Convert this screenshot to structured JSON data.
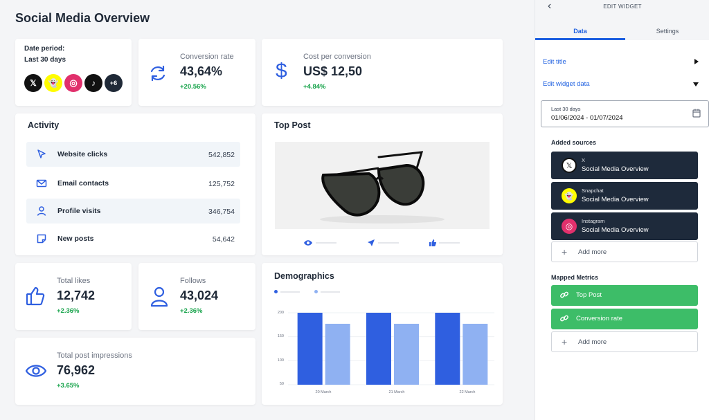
{
  "page": {
    "title": "Social Media Overview"
  },
  "date_card": {
    "label": "Date period:",
    "value": "Last 30 days",
    "networks": [
      {
        "name": "X",
        "glyph": "𝕏",
        "icon": "x-logo-icon"
      },
      {
        "name": "Snapchat",
        "glyph": "👻",
        "icon": "snapchat-logo-icon"
      },
      {
        "name": "Instagram",
        "glyph": "◎",
        "icon": "instagram-logo-icon"
      },
      {
        "name": "TikTok",
        "glyph": "♪",
        "icon": "tiktok-logo-icon"
      }
    ],
    "more_count": "+6"
  },
  "conversion": {
    "label": "Conversion rate",
    "value": "43,64%",
    "change": "+20.56%",
    "icon": "refresh-icon"
  },
  "cost": {
    "label": "Cost per conversion",
    "value": "US$ 12,50",
    "change": "+4.84%",
    "icon": "dollar-icon"
  },
  "activity": {
    "title": "Activity",
    "rows": [
      {
        "label": "Website clicks",
        "value": "542,852",
        "icon": "cursor-icon"
      },
      {
        "label": "Email contacts",
        "value": "125,752",
        "icon": "mail-icon"
      },
      {
        "label": "Profile visits",
        "value": "346,754",
        "icon": "user-icon"
      },
      {
        "label": "New posts",
        "value": "54,642",
        "icon": "note-icon"
      }
    ]
  },
  "top_post": {
    "title": "Top Post",
    "image": "sunglasses-image",
    "stats_icons": [
      "eye-icon",
      "share-icon",
      "thumbs-up-icon"
    ]
  },
  "likes": {
    "label": "Total likes",
    "value": "12,742",
    "change": "+2.36%",
    "icon": "thumbs-up-icon"
  },
  "follows": {
    "label": "Follows",
    "value": "43,024",
    "change": "+2.36%",
    "icon": "user-icon"
  },
  "impressions": {
    "label": "Total post impressions",
    "value": "76,962",
    "change": "+3.65%",
    "icon": "eye-icon"
  },
  "demographics": {
    "title": "Demographics",
    "colors": {
      "series1": "#2f5fe0",
      "series2": "#8fb1f2"
    },
    "chart_data": {
      "type": "bar",
      "categories": [
        "20 March",
        "21 March",
        "22 March"
      ],
      "series": [
        {
          "values": [
            200,
            200,
            200
          ]
        },
        {
          "values": [
            177,
            177,
            177
          ]
        }
      ],
      "yticks": [
        "200",
        "150",
        "100",
        "50"
      ],
      "ylim": [
        50,
        200
      ],
      "grid": true,
      "legend": "top-left"
    }
  },
  "panel": {
    "header": "EDIT WIDGET",
    "back_glyph": "‹",
    "tabs": [
      {
        "label": "Data",
        "active": true
      },
      {
        "label": "Settings",
        "active": false
      }
    ],
    "edit_title": "Edit title",
    "edit_data": "Edit widget data",
    "date_small": "Last 30 days",
    "date_range": "01/06/2024 - 01/07/2024",
    "added_sources_label": "Added sources",
    "sources": [
      {
        "network": "X",
        "name": "Social Media Overview",
        "glyph": "𝕏",
        "icon": "x-logo-icon"
      },
      {
        "network": "Snapchat",
        "name": "Social Media Overview",
        "glyph": "👻",
        "icon": "snapchat-logo-icon"
      },
      {
        "network": "Instagram",
        "name": "Social Media Overview",
        "glyph": "◎",
        "icon": "instagram-logo-icon"
      }
    ],
    "add_more": "Add more",
    "mapped_metrics_label": "Mapped Metrics",
    "metrics": [
      {
        "label": "Top Post"
      },
      {
        "label": "Conversion rate"
      }
    ],
    "accent": "#1d5fe0",
    "metric_color": "#3dbd68",
    "source_color": "#1e2a3b"
  }
}
